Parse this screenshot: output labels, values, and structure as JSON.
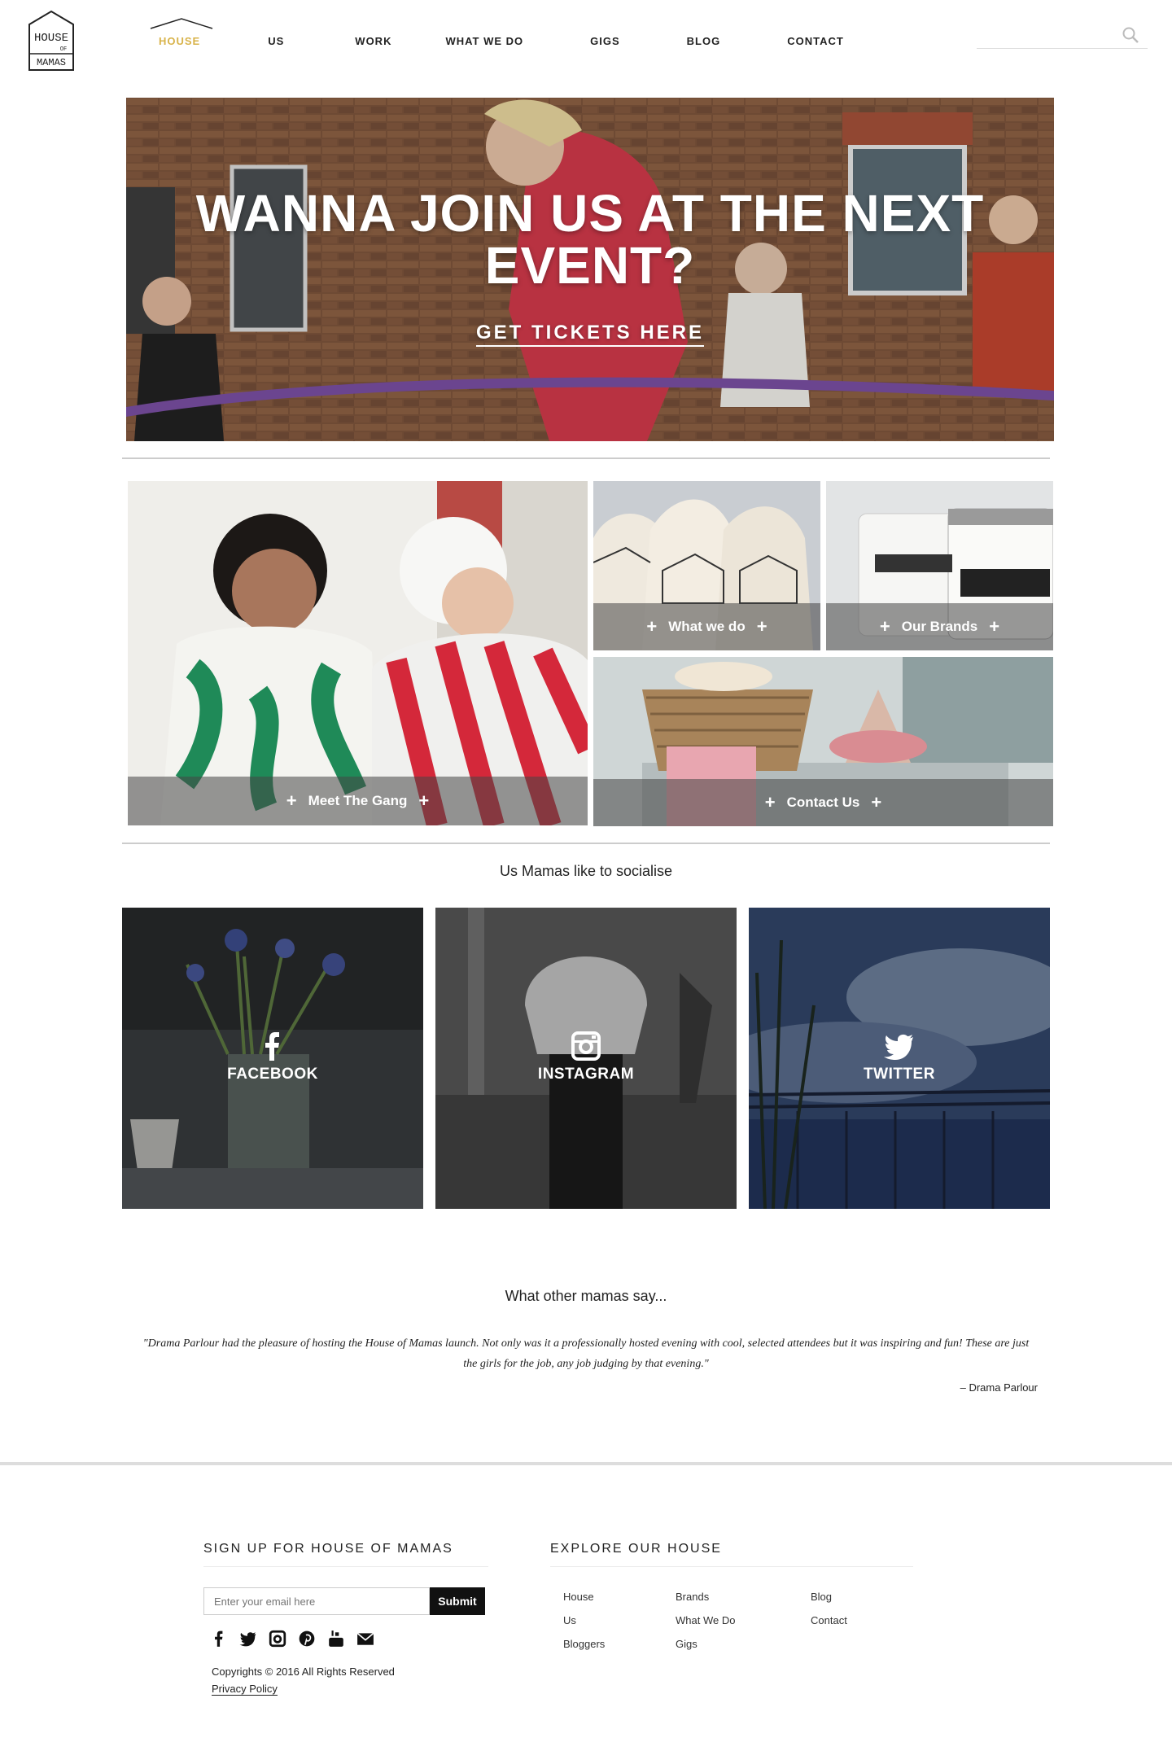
{
  "logo": {
    "line1": "HOUSE",
    "line2": "OF",
    "line3": "MAMAS"
  },
  "nav": {
    "items": [
      {
        "label": "HOUSE",
        "active": true
      },
      {
        "label": "US",
        "active": false
      },
      {
        "label": "WORK",
        "active": false
      },
      {
        "label": "WHAT WE DO",
        "active": false
      },
      {
        "label": "GIGS",
        "active": false
      },
      {
        "label": "BLOG",
        "active": false
      },
      {
        "label": "CONTACT",
        "active": false
      }
    ],
    "accent_color": "#d8b34a",
    "search_placeholder": ""
  },
  "hero": {
    "title": "WANNA JOIN US AT THE NEXT EVENT?",
    "link": "GET TICKETS HERE"
  },
  "tiles": {
    "meet_gang": "Meet The Gang",
    "what_we_do": "What we do",
    "our_brands": "Our Brands",
    "contact_us": "Contact Us",
    "plus": "+"
  },
  "social": {
    "heading": "Us Mamas like to socialise",
    "facebook": "FACEBOOK",
    "instagram": "INSTAGRAM",
    "twitter": "TWITTER"
  },
  "testimonials": {
    "heading": "What other mamas say...",
    "quote": "\"Drama Parlour had the pleasure of hosting the House of Mamas launch. Not only was it a professionally hosted evening with cool, selected attendees but it was inspiring and fun! These are just the girls for the job, any job judging by that evening.\"",
    "author": "– Drama Parlour"
  },
  "footer": {
    "signup_heading": "SIGN UP FOR HOUSE OF MAMAS",
    "email_placeholder": "Enter your email here",
    "submit": "Submit",
    "copyright": "Copyrights © 2016 All Rights Reserved",
    "privacy": "Privacy Policy",
    "explore_heading": "EXPLORE OUR HOUSE",
    "links": {
      "house": "House",
      "us": "Us",
      "bloggers": "Bloggers",
      "brands": "Brands",
      "what_we_do": "What We Do",
      "gigs": "Gigs",
      "blog": "Blog",
      "contact": "Contact"
    }
  }
}
